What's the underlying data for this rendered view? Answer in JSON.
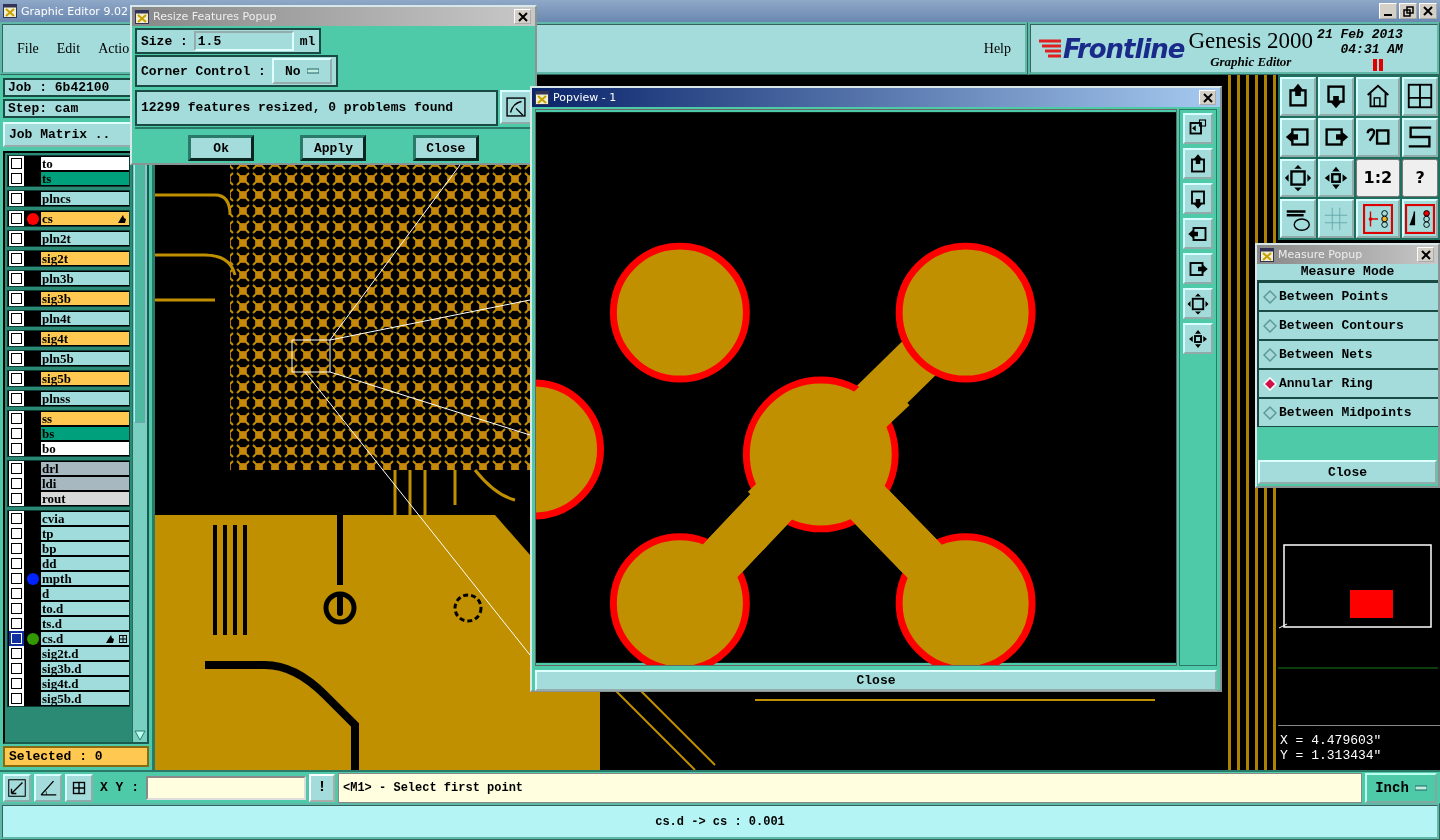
{
  "main_window": {
    "title": "Graphic Editor 9.02"
  },
  "menu": [
    "File",
    "Edit",
    "Actio",
    "Help"
  ],
  "brand": {
    "logo": "Frontline",
    "product": "Genesis 2000",
    "subtitle": "Graphic Editor",
    "date": "21 Feb 2013",
    "time": "04:31 AM"
  },
  "job": "Job : 6b42100",
  "step": "Step: cam",
  "job_matrix_button": "Job Matrix ..",
  "layer_groups": [
    [
      {
        "name": "to",
        "color": "#ffffff",
        "work": false,
        "attached": false,
        "selected": false
      },
      {
        "name": "ts",
        "color": "#00a07c",
        "work": false,
        "attached": false,
        "selected": false
      }
    ],
    [
      {
        "name": "plncs",
        "color": "#a0dcdc",
        "work": false,
        "attached": false,
        "selected": false
      }
    ],
    [
      {
        "name": "cs",
        "color": "#ffc850",
        "marker": {
          "color": "#ff0000"
        },
        "work": true,
        "attached": false,
        "selected": false
      }
    ],
    [
      {
        "name": "pln2t",
        "color": "#a0dcdc",
        "work": false,
        "attached": false,
        "selected": false
      }
    ],
    [
      {
        "name": "sig2t",
        "color": "#ffc850",
        "work": false,
        "attached": false,
        "selected": false
      }
    ],
    [
      {
        "name": "pln3b",
        "color": "#a0dcdc",
        "work": false,
        "attached": false,
        "selected": false
      }
    ],
    [
      {
        "name": "sig3b",
        "color": "#ffc850",
        "work": false,
        "attached": false,
        "selected": false
      }
    ],
    [
      {
        "name": "pln4t",
        "color": "#a0dcdc",
        "work": false,
        "attached": false,
        "selected": false
      }
    ],
    [
      {
        "name": "sig4t",
        "color": "#ffc850",
        "work": false,
        "attached": false,
        "selected": false
      }
    ],
    [
      {
        "name": "pln5b",
        "color": "#a0dcdc",
        "work": false,
        "attached": false,
        "selected": false
      }
    ],
    [
      {
        "name": "sig5b",
        "color": "#ffc850",
        "work": false,
        "attached": false,
        "selected": false
      }
    ],
    [
      {
        "name": "plnss",
        "color": "#a0dcdc",
        "work": false,
        "attached": false,
        "selected": false
      }
    ],
    [
      {
        "name": "ss",
        "color": "#ffc850",
        "work": false,
        "attached": false,
        "selected": false
      },
      {
        "name": "bs",
        "color": "#00a07c",
        "work": false,
        "attached": false,
        "selected": false
      },
      {
        "name": "bo",
        "color": "#ffffff",
        "work": false,
        "attached": false,
        "selected": false
      }
    ],
    [
      {
        "name": "drl",
        "color": "#a8b8c0",
        "work": false,
        "attached": false,
        "selected": false
      },
      {
        "name": "ldi",
        "color": "#a8b8c0",
        "work": false,
        "attached": false,
        "selected": false
      },
      {
        "name": "rout",
        "color": "#d8d8d8",
        "work": false,
        "attached": false,
        "selected": false
      }
    ],
    [
      {
        "name": "cvia",
        "color": "#a0dcdc",
        "work": false,
        "attached": false,
        "selected": false
      },
      {
        "name": "tp",
        "color": "#a0dcdc",
        "work": false,
        "attached": false,
        "selected": false
      },
      {
        "name": "bp",
        "color": "#a0dcdc",
        "work": false,
        "attached": false,
        "selected": false
      },
      {
        "name": "dd",
        "color": "#a0dcdc",
        "work": false,
        "attached": false,
        "selected": false
      },
      {
        "name": "mpth",
        "color": "#a0dcdc",
        "marker": {
          "color": "#0022ff"
        },
        "work": false,
        "attached": false,
        "selected": false
      },
      {
        "name": "d",
        "color": "#a0dcdc",
        "work": false,
        "attached": false,
        "selected": false
      },
      {
        "name": "to.d",
        "color": "#a0dcdc",
        "work": false,
        "attached": false,
        "selected": false
      },
      {
        "name": "ts.d",
        "color": "#a0dcdc",
        "work": false,
        "attached": false,
        "selected": false
      },
      {
        "name": "cs.d",
        "color": "#a0dcdc",
        "marker": {
          "color": "#339900"
        },
        "work": true,
        "attached": true,
        "selected": true
      },
      {
        "name": "sig2t.d",
        "color": "#a0dcdc",
        "work": false,
        "attached": false,
        "selected": false
      },
      {
        "name": "sig3b.d",
        "color": "#a0dcdc",
        "work": false,
        "attached": false,
        "selected": false
      },
      {
        "name": "sig4t.d",
        "color": "#a0dcdc",
        "work": false,
        "attached": false,
        "selected": false
      },
      {
        "name": "sig5b.d",
        "color": "#a0dcdc",
        "work": false,
        "attached": false,
        "selected": false
      }
    ]
  ],
  "selected_count": "Selected : 0",
  "view_toolbar_texts": [
    "1:2",
    "?"
  ],
  "coordinates": {
    "x": "X = 4.479603\"",
    "y": "Y = 1.313434\""
  },
  "command_bar": {
    "label": "X Y :",
    "alert_button": "!",
    "message": "<M1> - Select first point",
    "units": "Inch"
  },
  "status_bar": "cs.d -> cs : 0.001",
  "resize_popup": {
    "title": "Resize Features Popup",
    "size_label": "Size :",
    "size_value": "1.5",
    "size_unit": "ml",
    "corner_label": "Corner Control :",
    "corner_value": "No",
    "result": "12299 features resized, 0 problems found",
    "buttons": [
      "Ok",
      "Apply",
      "Close"
    ]
  },
  "popview": {
    "title": "Popview - 1",
    "close_button": "Close"
  },
  "measure_popup": {
    "title": "Measure Popup",
    "heading": "Measure Mode",
    "modes": [
      {
        "label": "Between Points",
        "selected": false
      },
      {
        "label": "Between Contours",
        "selected": false
      },
      {
        "label": "Between Nets",
        "selected": false
      },
      {
        "label": "Annular Ring",
        "selected": true
      },
      {
        "label": "Between Midpoints",
        "selected": false
      }
    ],
    "close_button": "Close"
  }
}
